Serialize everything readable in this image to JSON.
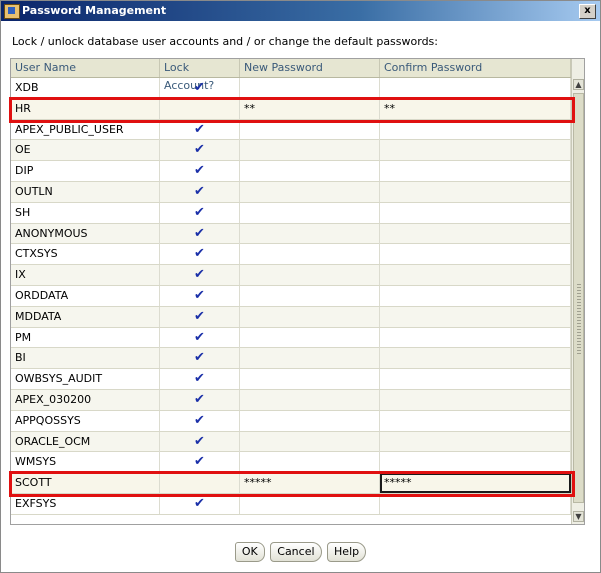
{
  "window": {
    "title": "Password Management",
    "close_label": "x"
  },
  "instruction": "Lock / unlock database user accounts and / or change the default passwords:",
  "table": {
    "columns": [
      "User Name",
      "Lock Account?",
      "New Password",
      "Confirm Password"
    ],
    "rows": [
      {
        "user": "XDB",
        "locked": true,
        "new_password": "",
        "confirm_password": ""
      },
      {
        "user": "HR",
        "locked": false,
        "new_password": "**",
        "confirm_password": "**"
      },
      {
        "user": "APEX_PUBLIC_USER",
        "locked": true,
        "new_password": "",
        "confirm_password": ""
      },
      {
        "user": "OE",
        "locked": true,
        "new_password": "",
        "confirm_password": ""
      },
      {
        "user": "DIP",
        "locked": true,
        "new_password": "",
        "confirm_password": ""
      },
      {
        "user": "OUTLN",
        "locked": true,
        "new_password": "",
        "confirm_password": ""
      },
      {
        "user": "SH",
        "locked": true,
        "new_password": "",
        "confirm_password": ""
      },
      {
        "user": "ANONYMOUS",
        "locked": true,
        "new_password": "",
        "confirm_password": ""
      },
      {
        "user": "CTXSYS",
        "locked": true,
        "new_password": "",
        "confirm_password": ""
      },
      {
        "user": "IX",
        "locked": true,
        "new_password": "",
        "confirm_password": ""
      },
      {
        "user": "ORDDATA",
        "locked": true,
        "new_password": "",
        "confirm_password": ""
      },
      {
        "user": "MDDATA",
        "locked": true,
        "new_password": "",
        "confirm_password": ""
      },
      {
        "user": "PM",
        "locked": true,
        "new_password": "",
        "confirm_password": ""
      },
      {
        "user": "BI",
        "locked": true,
        "new_password": "",
        "confirm_password": ""
      },
      {
        "user": "OWBSYS_AUDIT",
        "locked": true,
        "new_password": "",
        "confirm_password": ""
      },
      {
        "user": "APEX_030200",
        "locked": true,
        "new_password": "",
        "confirm_password": ""
      },
      {
        "user": "APPQOSSYS",
        "locked": true,
        "new_password": "",
        "confirm_password": ""
      },
      {
        "user": "ORACLE_OCM",
        "locked": true,
        "new_password": "",
        "confirm_password": ""
      },
      {
        "user": "WMSYS",
        "locked": true,
        "new_password": "",
        "confirm_password": ""
      },
      {
        "user": "SCOTT",
        "locked": false,
        "new_password": "*****",
        "confirm_password": "*****"
      },
      {
        "user": "EXFSYS",
        "locked": true,
        "new_password": "",
        "confirm_password": ""
      }
    ],
    "checkmark": "✔",
    "highlight_color": "#e01010"
  },
  "buttons": {
    "ok": "OK",
    "cancel": "Cancel",
    "help": "Help"
  }
}
